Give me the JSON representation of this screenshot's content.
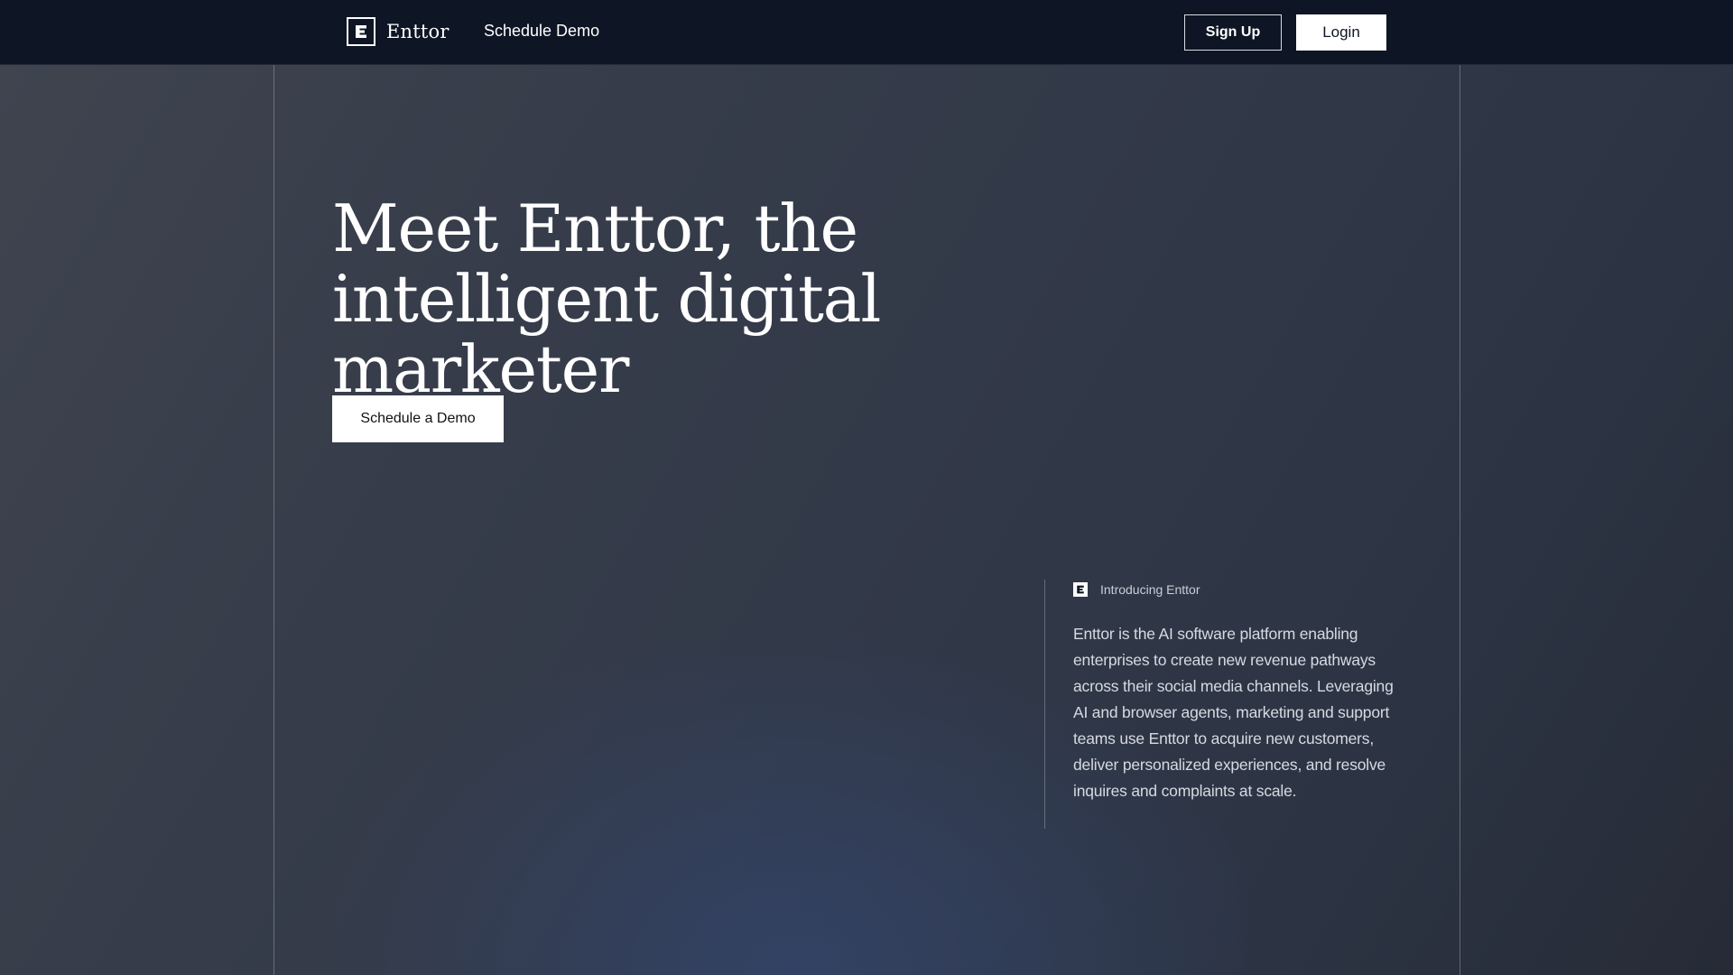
{
  "navbar": {
    "brand_name": "Enttor",
    "logo_icon": "enttor-logo-icon",
    "schedule_demo_link": "Schedule Demo",
    "signup_label": "Sign Up",
    "login_label": "Login"
  },
  "hero": {
    "title": "Meet Enttor, the intelligent digital marketer",
    "cta_label": "Schedule a Demo"
  },
  "intro": {
    "label": "Introducing Enttor",
    "text": "Enttor is the AI software platform enabling enterprises to create new revenue pathways across their social media channels. Leveraging AI and browser agents, marketing and support teams use Enttor to acquire new customers, deliver personalized experiences, and resolve inquires and complaints at scale."
  },
  "colors": {
    "navbar_bg": "#0e1524",
    "hero_bg": "#2f3745",
    "button_bg": "#ffffff",
    "text_primary": "#ffffff",
    "text_secondary": "#d6dae1"
  }
}
